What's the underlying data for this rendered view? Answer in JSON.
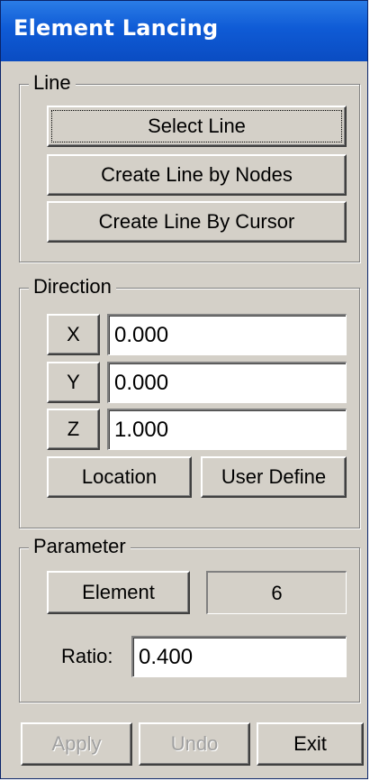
{
  "window": {
    "title": "Element Lancing"
  },
  "line_group": {
    "legend": "Line",
    "select_line": "Select Line",
    "create_by_nodes": "Create Line by Nodes",
    "create_by_cursor": "Create Line By Cursor"
  },
  "direction_group": {
    "legend": "Direction",
    "x_label": "X",
    "x_value": "0.000",
    "y_label": "Y",
    "y_value": "0.000",
    "z_label": "Z",
    "z_value": "1.000",
    "location": "Location",
    "user_define": "User Define"
  },
  "parameter_group": {
    "legend": "Parameter",
    "element": "Element",
    "element_count": "6",
    "ratio_label": "Ratio:",
    "ratio_value": "0.400"
  },
  "footer": {
    "apply": "Apply",
    "undo": "Undo",
    "exit": "Exit"
  },
  "colors": {
    "title_bar": "#0f5bd6",
    "panel": "#d4d0c8",
    "disabled_text": "#a0a0a0"
  }
}
